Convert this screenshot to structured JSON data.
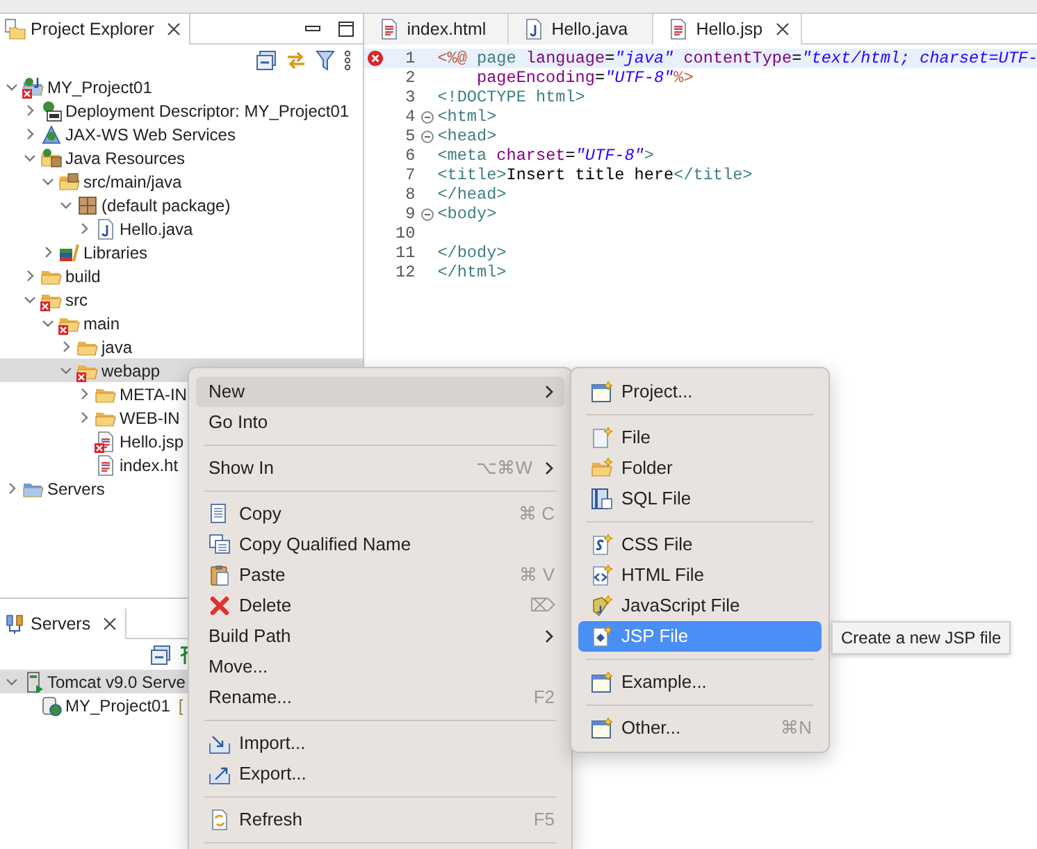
{
  "explorer": {
    "tab": {
      "label": "Project Explorer"
    },
    "tree": [
      {
        "label": "MY_Project01",
        "kind": "project",
        "error": true,
        "expanded": true,
        "selected": false,
        "children": [
          {
            "label": "Deployment Descriptor: MY_Project01",
            "kind": "descriptor",
            "error": false,
            "expanded": false,
            "selected": false
          },
          {
            "label": "JAX-WS Web Services",
            "kind": "webservice",
            "error": false,
            "expanded": false,
            "selected": false
          },
          {
            "label": "Java Resources",
            "kind": "java-resources",
            "error": false,
            "expanded": true,
            "selected": false,
            "children": [
              {
                "label": "src/main/java",
                "kind": "source-folder",
                "error": false,
                "expanded": true,
                "selected": false,
                "children": [
                  {
                    "label": "(default package)",
                    "kind": "package",
                    "error": false,
                    "expanded": true,
                    "selected": false,
                    "children": [
                      {
                        "label": "Hello.java",
                        "kind": "java-file",
                        "error": false,
                        "expanded": false,
                        "selected": false
                      }
                    ]
                  }
                ]
              },
              {
                "label": "Libraries",
                "kind": "libraries",
                "error": false,
                "expanded": false,
                "selected": false
              }
            ]
          },
          {
            "label": "build",
            "kind": "folder",
            "error": false,
            "expanded": false,
            "selected": false
          },
          {
            "label": "src",
            "kind": "folder",
            "error": true,
            "expanded": true,
            "selected": false,
            "children": [
              {
                "label": "main",
                "kind": "folder",
                "error": true,
                "expanded": true,
                "selected": false,
                "children": [
                  {
                    "label": "java",
                    "kind": "folder",
                    "error": false,
                    "expanded": false,
                    "selected": false
                  },
                  {
                    "label": "webapp",
                    "kind": "folder",
                    "error": true,
                    "expanded": true,
                    "selected": true,
                    "children": [
                      {
                        "label": "META-IN",
                        "kind": "folder",
                        "error": false,
                        "expanded": false,
                        "selected": false
                      },
                      {
                        "label": "WEB-IN",
                        "kind": "folder",
                        "error": false,
                        "expanded": false,
                        "selected": false
                      },
                      {
                        "label": "Hello.jsp",
                        "kind": "page-file",
                        "error": true,
                        "selected": false
                      },
                      {
                        "label": "index.ht",
                        "kind": "page-file",
                        "error": false,
                        "selected": false
                      }
                    ]
                  }
                ]
              }
            ]
          }
        ]
      },
      {
        "label": "Servers",
        "kind": "servers",
        "error": false,
        "expanded": false,
        "selected": false
      }
    ]
  },
  "servers": {
    "tab": {
      "label": "Servers"
    },
    "tree": [
      {
        "label": "Tomcat v9.0 Serve",
        "kind": "server",
        "error": false,
        "expanded": true,
        "selected": true,
        "children": [
          {
            "label": "MY_Project01",
            "status": "[",
            "kind": "module",
            "error": false,
            "selected": false
          }
        ]
      }
    ]
  },
  "editor": {
    "tabs": [
      {
        "label": "index.html",
        "kind": "page-file",
        "selected": false
      },
      {
        "label": "Hello.java",
        "kind": "java-file",
        "selected": false
      },
      {
        "label": "Hello.jsp",
        "kind": "page-file",
        "selected": true
      }
    ],
    "lines": [
      {
        "number": "1",
        "error": true,
        "current": true,
        "fold": false,
        "segments": [
          {
            "kind": "jsp",
            "text": "<%@"
          },
          {
            "kind": "dir",
            "text": " page "
          },
          {
            "kind": "attr",
            "text": "language"
          },
          {
            "kind": "plain",
            "text": "="
          },
          {
            "kind": "val",
            "text": "\"java\" "
          },
          {
            "kind": "attr",
            "text": "contentType"
          },
          {
            "kind": "plain",
            "text": "="
          },
          {
            "kind": "val",
            "text": "\"text/html; charset=UTF-"
          }
        ]
      },
      {
        "number": "2",
        "error": false,
        "current": false,
        "fold": false,
        "segments": [
          {
            "kind": "attr",
            "text": "    pageEncoding"
          },
          {
            "kind": "plain",
            "text": "="
          },
          {
            "kind": "val",
            "text": "\"UTF-8\""
          },
          {
            "kind": "jsp",
            "text": "%>"
          }
        ]
      },
      {
        "number": "3",
        "error": false,
        "current": false,
        "fold": false,
        "segments": [
          {
            "kind": "tag",
            "text": "<!DOCTYPE html>"
          }
        ]
      },
      {
        "number": "4",
        "error": false,
        "current": false,
        "fold": true,
        "segments": [
          {
            "kind": "tag",
            "text": "<html>"
          }
        ]
      },
      {
        "number": "5",
        "error": false,
        "current": false,
        "fold": true,
        "segments": [
          {
            "kind": "tag",
            "text": "<head>"
          }
        ]
      },
      {
        "number": "6",
        "error": false,
        "current": false,
        "fold": false,
        "segments": [
          {
            "kind": "tag",
            "text": "<meta "
          },
          {
            "kind": "attr",
            "text": "charset"
          },
          {
            "kind": "plain",
            "text": "="
          },
          {
            "kind": "val",
            "text": "\"UTF-8\""
          },
          {
            "kind": "tag",
            "text": ">"
          }
        ]
      },
      {
        "number": "7",
        "error": false,
        "current": false,
        "fold": false,
        "segments": [
          {
            "kind": "tag",
            "text": "<title>"
          },
          {
            "kind": "plain",
            "text": "Insert title here"
          },
          {
            "kind": "tag",
            "text": "</title>"
          }
        ]
      },
      {
        "number": "8",
        "error": false,
        "current": false,
        "fold": false,
        "segments": [
          {
            "kind": "tag",
            "text": "</head>"
          }
        ]
      },
      {
        "number": "9",
        "error": false,
        "current": false,
        "fold": true,
        "segments": [
          {
            "kind": "tag",
            "text": "<body>"
          }
        ]
      },
      {
        "number": "10",
        "error": false,
        "current": false,
        "fold": false
      },
      {
        "number": "11",
        "error": false,
        "current": false,
        "fold": false,
        "segments": [
          {
            "kind": "tag",
            "text": "</body>"
          }
        ]
      },
      {
        "number": "12",
        "error": false,
        "current": false,
        "fold": false,
        "segments": [
          {
            "kind": "tag",
            "text": "</html>"
          }
        ]
      }
    ]
  },
  "context_menu": {
    "items": [
      {
        "kind": "item",
        "label": "New",
        "submenu": true,
        "selected": true
      },
      {
        "kind": "item",
        "label": "Go Into",
        "selected": false
      },
      {
        "kind": "separator"
      },
      {
        "kind": "item",
        "label": "Show In",
        "shortcut": "⌥⌘W",
        "submenu": true,
        "selected": false
      },
      {
        "kind": "separator"
      },
      {
        "kind": "copy",
        "label": "Copy",
        "shortcut": "⌘ C",
        "selected": false
      },
      {
        "kind": "copy-name",
        "label": "Copy Qualified Name",
        "selected": false
      },
      {
        "kind": "paste",
        "label": "Paste",
        "shortcut": "⌘ V",
        "selected": false
      },
      {
        "kind": "delete",
        "label": "Delete",
        "shortcut": "⌦",
        "selected": false
      },
      {
        "kind": "item",
        "label": "Build Path",
        "submenu": true,
        "selected": false
      },
      {
        "kind": "item",
        "label": "Move...",
        "selected": false
      },
      {
        "kind": "item",
        "label": "Rename...",
        "shortcut": "F2",
        "selected": false
      },
      {
        "kind": "separator"
      },
      {
        "kind": "import",
        "label": "Import...",
        "selected": false
      },
      {
        "kind": "export",
        "label": "Export...",
        "selected": false
      },
      {
        "kind": "separator"
      },
      {
        "kind": "refresh",
        "label": "Refresh",
        "shortcut": "F5",
        "selected": false
      },
      {
        "kind": "separator"
      }
    ]
  },
  "submenu": {
    "items": [
      {
        "kind": "new-project",
        "label": "Project...",
        "selected": false
      },
      {
        "kind": "separator"
      },
      {
        "kind": "new-file",
        "label": "File",
        "selected": false
      },
      {
        "kind": "new-folder",
        "label": "Folder",
        "selected": false
      },
      {
        "kind": "sql",
        "label": "SQL File",
        "selected": false
      },
      {
        "kind": "separator"
      },
      {
        "kind": "css",
        "label": "CSS File",
        "selected": false
      },
      {
        "kind": "html",
        "label": "HTML File",
        "selected": false
      },
      {
        "kind": "javascript",
        "label": "JavaScript File",
        "selected": false
      },
      {
        "kind": "jsp",
        "label": "JSP File",
        "selected": true
      },
      {
        "kind": "separator"
      },
      {
        "kind": "new-project",
        "label": "Example...",
        "selected": false
      },
      {
        "kind": "separator"
      },
      {
        "kind": "new-project",
        "label": "Other...",
        "shortcut": "⌘N",
        "selected": false
      }
    ]
  },
  "tooltip": {
    "text": "Create a new JSP file"
  }
}
